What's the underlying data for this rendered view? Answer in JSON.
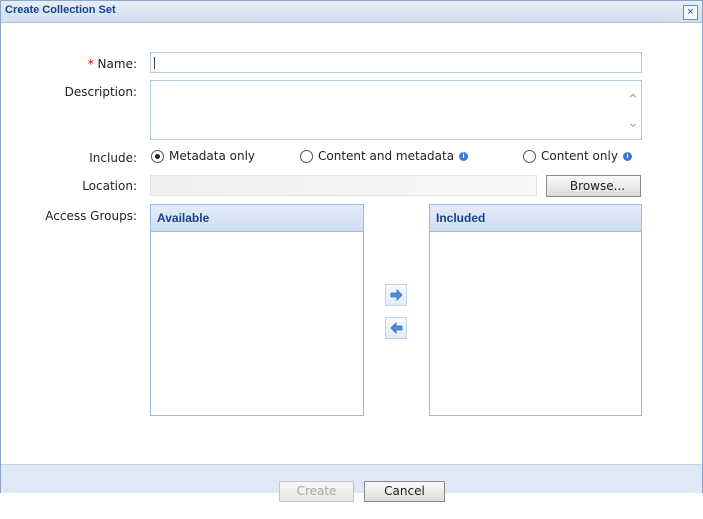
{
  "dialog": {
    "title": "Create Collection Set",
    "close_glyph": "×",
    "close_icon": "close-icon"
  },
  "form": {
    "name_required_marker": "*",
    "name_label": "Name:",
    "name_value": "",
    "description_label": "Description:",
    "description_value": "",
    "include_label": "Include:",
    "include_options": [
      {
        "label": "Metadata only",
        "selected": true
      },
      {
        "label": "Content and metadata",
        "selected": false,
        "info_icon": "info-icon"
      },
      {
        "label": "Content only",
        "selected": false,
        "info_icon": "info-icon"
      }
    ],
    "info_glyph": "i",
    "location_label": "Location:",
    "location_value": "",
    "browse_label": "Browse...",
    "access_groups_label": "Access Groups:",
    "available_header": "Available",
    "included_header": "Included",
    "move_right_icon": "arrow-right-icon",
    "move_left_icon": "arrow-left-icon"
  },
  "footer": {
    "create_label": "Create",
    "create_enabled": false,
    "cancel_label": "Cancel"
  },
  "colors": {
    "title_text": "#15428b",
    "required": "#dd0000",
    "info_icon": "#3e7bd0",
    "arrow_icon": "#4a8de0"
  }
}
